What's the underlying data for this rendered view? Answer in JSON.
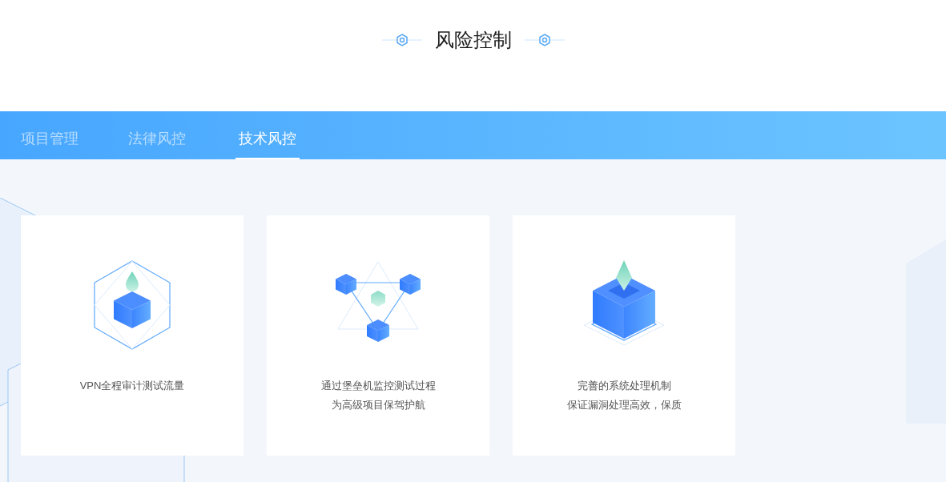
{
  "heading": {
    "title": "风险控制"
  },
  "tabs": [
    {
      "label": "项目管理",
      "selected": false
    },
    {
      "label": "法律风控",
      "selected": false
    },
    {
      "label": "技术风控",
      "selected": true
    }
  ],
  "cards": [
    {
      "kind": "hexagon",
      "lines": [
        "VPN全程审计测试流量"
      ]
    },
    {
      "kind": "network",
      "lines": [
        "通过堡垒机监控测试过程",
        "为高级项目保驾护航"
      ]
    },
    {
      "kind": "crystal",
      "lines": [
        "完善的系统处理机制",
        "保证漏洞处理高效，保质"
      ]
    }
  ]
}
